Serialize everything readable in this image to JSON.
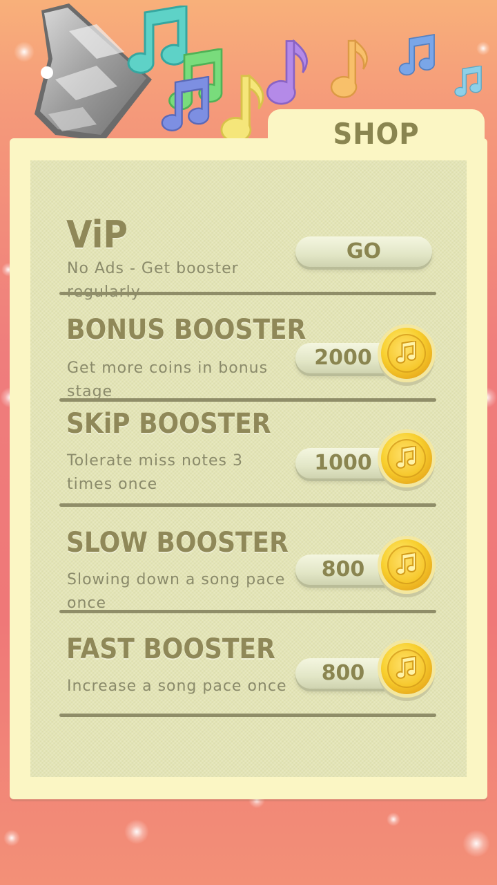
{
  "shop": {
    "title": "SHOP"
  },
  "items": [
    {
      "title": "ViP",
      "description": "No Ads - Get booster regularly",
      "button_label": "GO"
    },
    {
      "title": "BONUS BOOSTER",
      "description": "Get more coins in bonus stage",
      "price": "2000",
      "icon": "music-note-coin-icon"
    },
    {
      "title": "SKiP BOOSTER",
      "description": "Tolerate miss notes 3 times once",
      "price": "1000",
      "icon": "music-note-coin-icon"
    },
    {
      "title": "SLOW BOOSTER",
      "description": "Slowing down a song pace once",
      "price": "800",
      "icon": "music-note-coin-icon"
    },
    {
      "title": "FAST BOOSTER",
      "description": "Increase a song pace once",
      "price": "800",
      "icon": "music-note-coin-icon"
    }
  ],
  "colors": {
    "background_top": "#f8b07a",
    "background_bottom": "#ef7878",
    "paper": "#fbf6c4",
    "panel": "#e4e5b6",
    "text": "#8f8858",
    "coin": "#f8cf2e"
  },
  "decorations": [
    "speaker-icon",
    "music-note-icon"
  ]
}
